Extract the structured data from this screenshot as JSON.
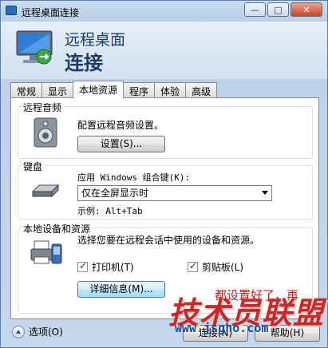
{
  "window": {
    "title": "远程桌面连接",
    "controls": {
      "minimize": "—",
      "maximize": "□",
      "close": "✕"
    }
  },
  "header": {
    "line1": "远程桌面",
    "line2": "连接"
  },
  "tabs": [
    {
      "label": "常规",
      "active": false
    },
    {
      "label": "显示",
      "active": false
    },
    {
      "label": "本地资源",
      "active": true
    },
    {
      "label": "程序",
      "active": false
    },
    {
      "label": "体验",
      "active": false
    },
    {
      "label": "高级",
      "active": false
    }
  ],
  "audio": {
    "group_label": "远程音频",
    "description": "配置远程音频设置。",
    "settings_button": "设置(S)..."
  },
  "keyboard": {
    "group_label": "键盘",
    "apply_label": "应用 Windows 组合键(K):",
    "selected_option": "仅在全屏显示时",
    "example": "示例: Alt+Tab"
  },
  "local_devices": {
    "group_label": "本地设备和资源",
    "description": "选择您要在远程会话中使用的设备和资源。",
    "printer": {
      "label": "打印机(T)",
      "checked": true
    },
    "clipboard": {
      "label": "剪贴板(L)",
      "checked": true
    },
    "details_button": "详细信息(M)..."
  },
  "footer": {
    "options_label": "选项(O)",
    "connect_button": "连接(N)",
    "help_button": "帮助(H)"
  },
  "overlay": {
    "annotation": "都设置好了，再",
    "watermark_main": "技术员联盟",
    "watermark_url": "www.jsgho.com"
  },
  "colors": {
    "title_blue": "#1d3c66",
    "annotation_red": "#d01818",
    "watermark_red": "#c52a2a",
    "watermark_blue": "#1b4e9a"
  }
}
